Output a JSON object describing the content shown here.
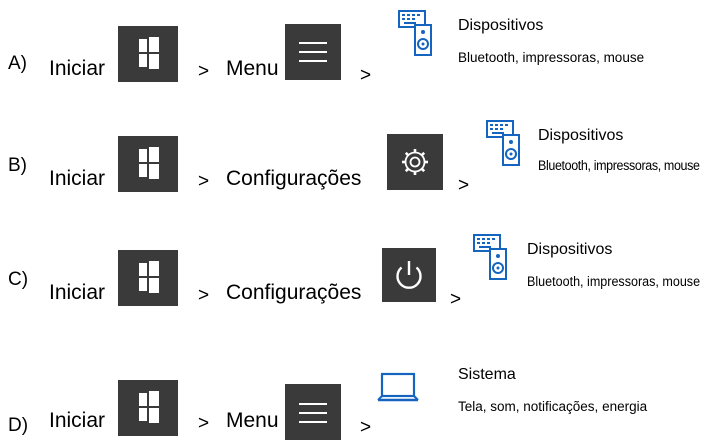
{
  "options": [
    {
      "letter": "A)",
      "start": "Iniciar",
      "sep1": ">",
      "step2": "Menu",
      "sep2": ">",
      "icon1": "windows-logo-icon",
      "icon2": "hamburger-menu-icon",
      "icon3": "devices-keyboard-speaker-icon",
      "card_title": "Dispositivos",
      "card_subtitle": "Bluetooth, impressoras, mouse"
    },
    {
      "letter": "B)",
      "start": "Iniciar",
      "sep1": ">",
      "step2": "Configurações",
      "sep2": ">",
      "icon1": "windows-logo-icon",
      "icon2": "gear-icon",
      "icon3": "devices-keyboard-speaker-icon",
      "card_title": "Dispositivos",
      "card_subtitle": "Bluetooth, impressoras, mouse"
    },
    {
      "letter": "C)",
      "start": "Iniciar",
      "sep1": ">",
      "step2": "Configurações",
      "sep2": ">",
      "icon1": "windows-logo-icon",
      "icon2": "power-icon",
      "icon3": "devices-keyboard-speaker-icon",
      "card_title": "Dispositivos",
      "card_subtitle": "Bluetooth, impressoras, mouse"
    },
    {
      "letter": "D)",
      "start": "Iniciar",
      "sep1": ">",
      "step2": "Menu",
      "sep2": ">",
      "icon1": "windows-logo-icon",
      "icon2": "hamburger-menu-icon",
      "icon3": "laptop-icon",
      "card_title": "Sistema",
      "card_subtitle": "Tela, som, notificações, energia"
    }
  ],
  "colors": {
    "tile_background": "#3a3a3a",
    "icon_white": "#ffffff",
    "accent_blue": "#1565c0",
    "text": "#000000"
  }
}
